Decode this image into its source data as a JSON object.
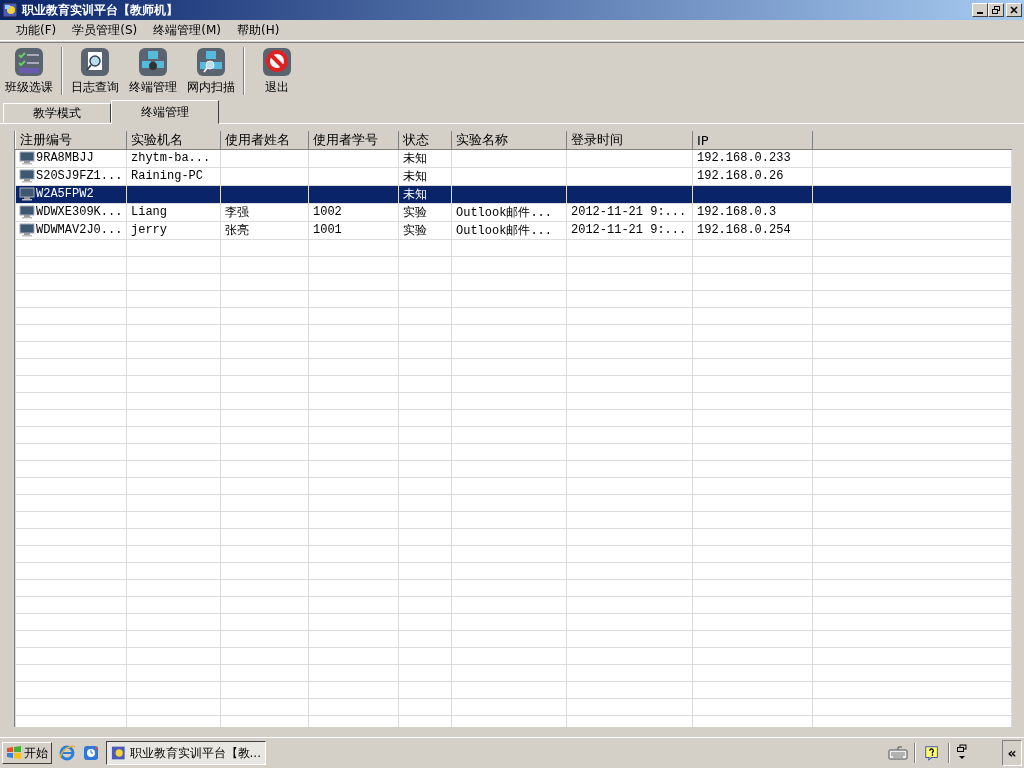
{
  "window": {
    "title": "职业教育实训平台【教师机】"
  },
  "menu": [
    "功能(F)",
    "学员管理(S)",
    "终端管理(M)",
    "帮助(H)"
  ],
  "toolbar": [
    {
      "label": "班级选课",
      "kind": "checklist"
    },
    {
      "label": "日志查询",
      "kind": "log"
    },
    {
      "label": "终端管理",
      "kind": "terminal"
    },
    {
      "label": "网内扫描",
      "kind": "scan"
    },
    {
      "label": "退出",
      "kind": "exit"
    }
  ],
  "tabs": [
    {
      "label": "教学模式",
      "selected": false
    },
    {
      "label": "终端管理",
      "selected": true
    }
  ],
  "table": {
    "columns": [
      "注册编号",
      "实验机名",
      "使用者姓名",
      "使用者学号",
      "状态",
      "实验名称",
      "登录时间",
      "IP"
    ],
    "rows": [
      {
        "selected": false,
        "cells": [
          "9RA8MBJJ",
          "zhytm-ba...",
          "",
          "",
          "未知",
          "",
          "",
          "192.168.0.233"
        ]
      },
      {
        "selected": false,
        "cells": [
          "S20SJ9FZ1...",
          "Raining-PC",
          "",
          "",
          "未知",
          "",
          "",
          "192.168.0.26"
        ]
      },
      {
        "selected": true,
        "cells": [
          "W2A5FPW2",
          "",
          "",
          "",
          "未知",
          "",
          "",
          ""
        ]
      },
      {
        "selected": false,
        "cells": [
          "WDWXE309K...",
          "Liang",
          "李强",
          "1002",
          "实验",
          "Outlook邮件...",
          "2012-11-21 9:...",
          "192.168.0.3"
        ]
      },
      {
        "selected": false,
        "cells": [
          "WDWMAV2J0...",
          "jerry",
          "张亮",
          "1001",
          "实验",
          "Outlook邮件...",
          "2012-11-21 9:...",
          "192.168.0.254"
        ]
      }
    ]
  },
  "taskbar": {
    "start": "开始",
    "task": "职业教育实训平台【教...",
    "collapse": "«"
  }
}
